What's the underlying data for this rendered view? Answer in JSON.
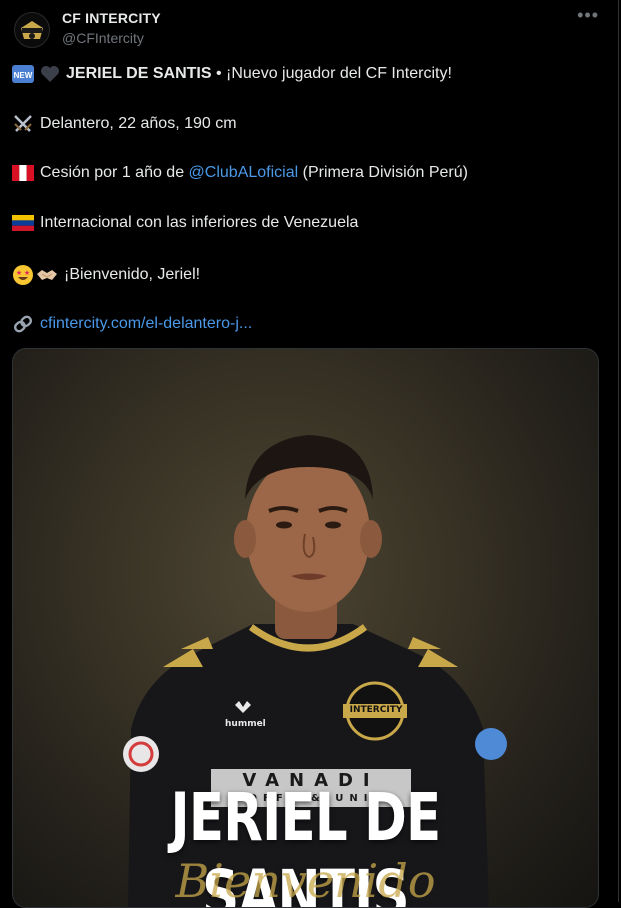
{
  "author": {
    "name": "CF INTERCITY",
    "handle": "@CFIntercity"
  },
  "icons": {
    "avatar": "cf-intercity-crest-logo",
    "more": "more-options-icon",
    "new": "new-badge-emoji",
    "heart": "black-heart-emoji",
    "swords": "crossed-swords-emoji",
    "peru": "peru-flag-emoji",
    "venezuela": "venezuela-flag-emoji",
    "starstruck": "star-struck-emoji",
    "handshake": "handshake-emoji",
    "link": "link-icon"
  },
  "tweet": {
    "line1_bold": "JERIEL DE SANTIS",
    "line1_rest": " • ¡Nuevo jugador del CF Intercity!",
    "line2": "Delantero, 22 años, 190 cm",
    "line3_pre": "Cesión por 1 año de ",
    "line3_mention": "@ClubALoficial",
    "line3_post": " (Primera División Perú)",
    "line4": "Internacional con las inferiores de Venezuela",
    "line5": "¡Bienvenido, Jeriel!",
    "link": "cfintercity.com/el-delantero-j..."
  },
  "media": {
    "title": "JERIEL DE SANTIS",
    "crest_text": "INTERCITY",
    "sponsor_text": "VANADI",
    "sponsor_sub": "OFFE & UNI",
    "kit_brand": "hummel",
    "script": "Bienvenido"
  },
  "colors": {
    "background": "#000000",
    "text": "#e7e9ea",
    "muted": "#71767b",
    "link": "#4a99e9",
    "gold": "#c9a84a"
  }
}
